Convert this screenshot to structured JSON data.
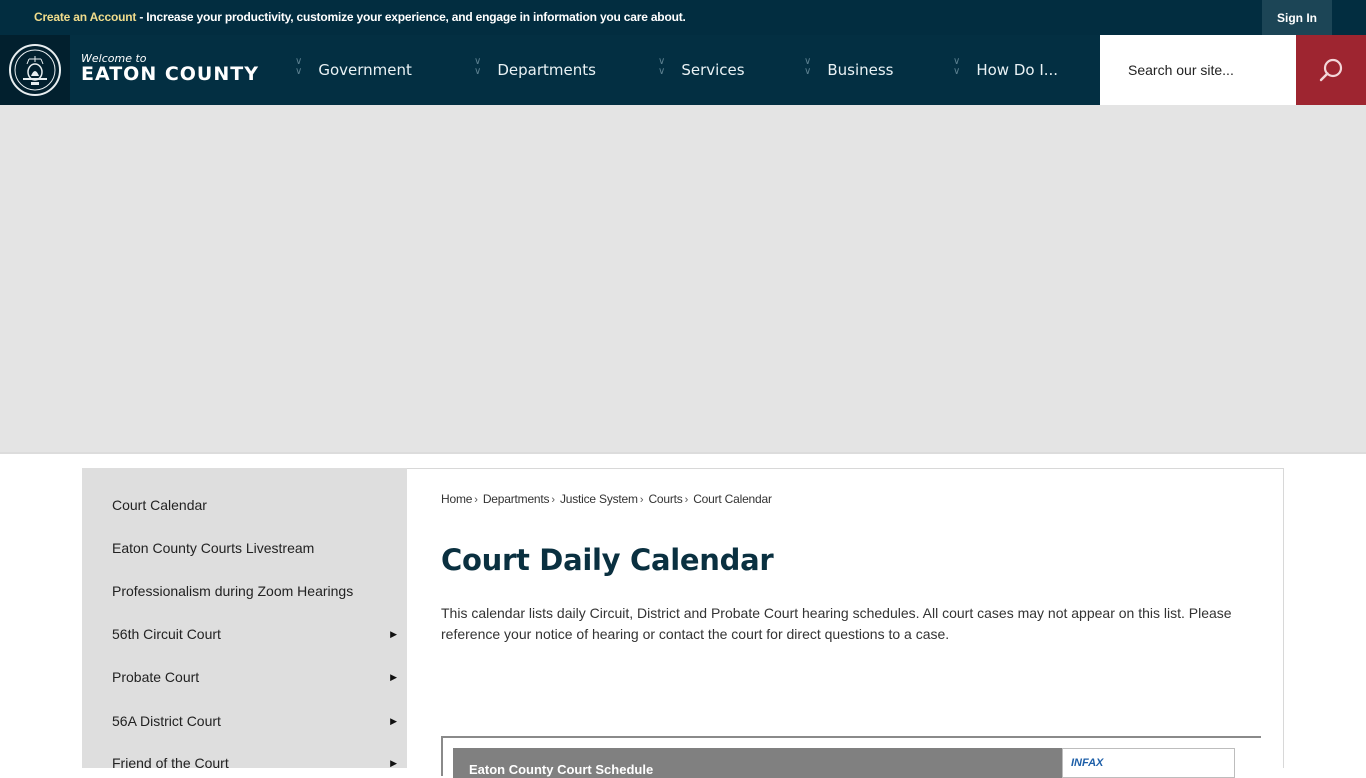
{
  "topbar": {
    "create_account_label": "Create an Account",
    "promo_text": " - Increase your productivity, customize your experience, and engage in information you care about.",
    "sign_in_label": "Sign In"
  },
  "header": {
    "welcome": "Welcome to",
    "site_name": "EATON COUNTY",
    "nav": [
      {
        "label": "Government"
      },
      {
        "label": "Departments"
      },
      {
        "label": "Services"
      },
      {
        "label": "Business"
      },
      {
        "label": "How Do I..."
      }
    ],
    "search": {
      "placeholder": "Search our site...",
      "value": ""
    }
  },
  "colors": {
    "topbar_bg": "#022d40",
    "header_bg": "#032f42",
    "search_button": "#9e2530",
    "create_account": "#f0dc8c",
    "title": "#0a3040"
  },
  "sidebar": {
    "items": [
      {
        "label": "Court Calendar",
        "has_submenu": false
      },
      {
        "label": "Eaton County Courts Livestream",
        "has_submenu": false
      },
      {
        "label": "Professionalism during Zoom Hearings",
        "has_submenu": false
      },
      {
        "label": "56th Circuit Court",
        "has_submenu": true
      },
      {
        "label": "Probate Court",
        "has_submenu": true
      },
      {
        "label": "56A District Court",
        "has_submenu": true
      },
      {
        "label": "Friend of the Court",
        "has_submenu": true
      }
    ]
  },
  "breadcrumb": {
    "items": [
      "Home",
      "Departments",
      "Justice System",
      "Courts"
    ],
    "current": "Court Calendar",
    "separator": "›"
  },
  "main": {
    "title": "Court Daily Calendar",
    "intro": "This calendar lists daily Circuit, District and Probate Court hearing schedules. All court cases may not appear on this list. Please reference your notice of hearing or contact the court for direct questions to a case."
  },
  "embed": {
    "title": "Eaton County Court Schedule",
    "vendor_logo": "INFAX"
  }
}
